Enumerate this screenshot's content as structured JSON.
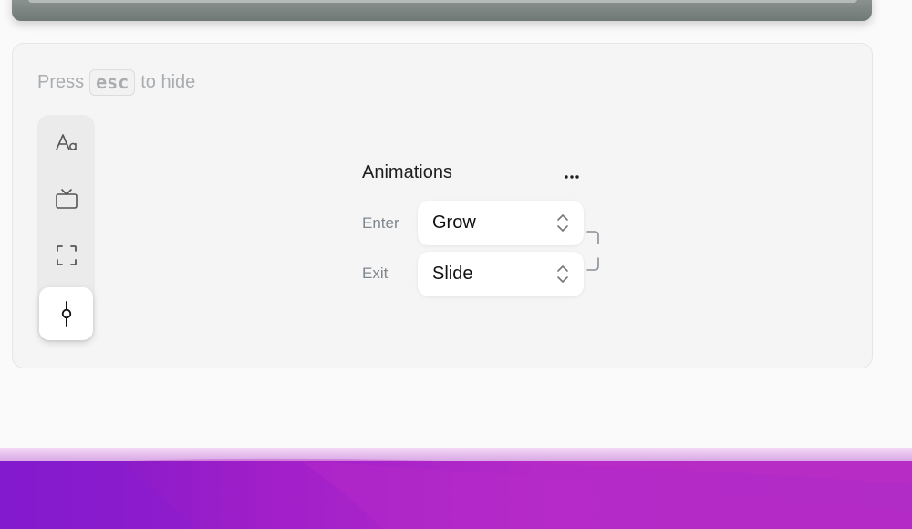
{
  "hint": {
    "press": "Press",
    "key": "esc",
    "suffix": "to hide"
  },
  "toolbar": {
    "tools": [
      {
        "icon": "text-format-icon",
        "active": false
      },
      {
        "icon": "tv-icon",
        "active": false
      },
      {
        "icon": "fullscreen-frame-icon",
        "active": false
      },
      {
        "icon": "keyframe-timeline-icon",
        "active": true
      }
    ]
  },
  "animations": {
    "title": "Animations",
    "more_icon": "more-horizontal-icon",
    "enter": {
      "label": "Enter",
      "value": "Grow"
    },
    "exit": {
      "label": "Exit",
      "value": "Slide"
    },
    "link_icon": "link-bracket-icon"
  },
  "colors": {
    "panel_bg": "#f5f5f5",
    "toolbar_bg": "#ebebeb",
    "muted_text": "#a9adb0",
    "label_text": "#7f868d",
    "wallpaper_purple": "#a11fc9"
  }
}
